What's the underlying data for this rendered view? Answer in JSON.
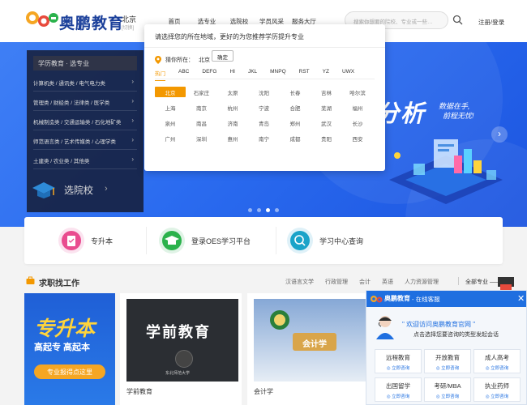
{
  "header": {
    "logo_text": "奥鹏教育",
    "city": "北京",
    "city_switch": "[切换]",
    "nav": [
      "首页",
      "选专业",
      "选院校",
      "学员风采",
      "服务大厅"
    ],
    "search_placeholder": "搜索你想要的院校、专业或一些…",
    "login": "注册/登录"
  },
  "banner": {
    "big_text": "分析",
    "sub_line1": "数据在手,",
    "sub_line2": "前程无忧!"
  },
  "category_menu": {
    "title": "学历教育 · 选专业",
    "items": [
      "计算机类 / 通讯类 / 电气电力类",
      "管理类 / 财经类 / 法律类 / 医学类",
      "机械制造类 / 交通运输类 / 石化地矿类",
      "师范语言类 / 艺术传媒类 / 心理学类",
      "土建类 / 农业类 / 其他类"
    ],
    "school_label": "选院校"
  },
  "quick_links": [
    "专升本",
    "登录OES学习平台",
    "学习中心查询"
  ],
  "section": {
    "title": "求职找工作",
    "tags": [
      "汉语言文学",
      "行政管理",
      "会计",
      "英语",
      "人力资源管理"
    ],
    "all_label": "全部专业 ——"
  },
  "cards": {
    "promo_title": "专升本",
    "promo_subtitle": "高起专  高起本",
    "promo_button": "专业报得点这里",
    "card2_title": "学前教育",
    "card2_uni": "东北师范大学",
    "card2_caption": "学前教育",
    "card3_label": "会计学",
    "card3_caption": "会计学"
  },
  "modal": {
    "title": "请选择您的所在地域，更好的为您推荐学历提升专业",
    "guess_label": "猜你所在：",
    "guess_city": "北京",
    "confirm_button": "确定",
    "tabs": [
      "热门",
      "ABC",
      "DEFG",
      "HI",
      "JKL",
      "MNPQ",
      "RST",
      "YZ",
      "UWX"
    ],
    "active_tab": 0,
    "cities": [
      [
        "北京",
        "石家庄",
        "太原",
        "沈阳",
        "长春",
        "吉林",
        "哈尔滨"
      ],
      [
        "上海",
        "南京",
        "杭州",
        "宁波",
        "合肥",
        "芜湖",
        "福州"
      ],
      [
        "泉州",
        "南昌",
        "济南",
        "青岛",
        "郑州",
        "武汉",
        "长沙"
      ],
      [
        "广州",
        "深圳",
        "惠州",
        "南宁",
        "成都",
        "贵阳",
        "西安"
      ]
    ]
  },
  "chat": {
    "logo_text": "奥鹏教育",
    "header_sub": "- 在线客服",
    "welcome": "\" 欢迎访问奥鹏教育官网 \"",
    "hint": "点击选择您要咨询的类型发起会话",
    "buttons": [
      {
        "title": "远程教育",
        "sub": "◎ 立即咨询"
      },
      {
        "title": "开放教育",
        "sub": "◎ 立即咨询"
      },
      {
        "title": "成人高考",
        "sub": "◎ 立即咨询"
      },
      {
        "title": "出国留学",
        "sub": "◎ 立即咨询"
      },
      {
        "title": "考研/MBA",
        "sub": "◎ 立即咨询"
      },
      {
        "title": "执业药师",
        "sub": "◎ 立即咨询"
      }
    ]
  },
  "colors": {
    "brand_blue": "#1f6fe0",
    "accent_orange": "#f39800",
    "banner_blue": "#2b6cf0"
  }
}
